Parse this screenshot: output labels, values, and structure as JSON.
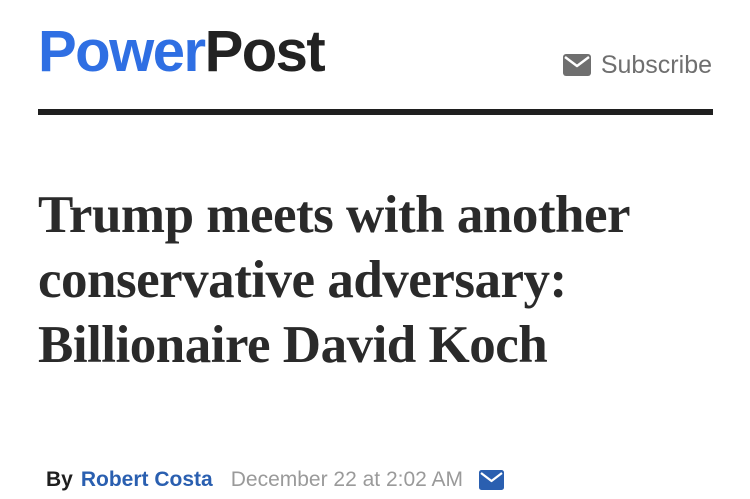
{
  "header": {
    "logo_part1": "Power",
    "logo_part2": "Post",
    "subscribe_label": "Subscribe",
    "subscribe_icon": "envelope-icon"
  },
  "article": {
    "headline": "Trump meets with another conservative adversary: Billionaire David Koch",
    "byline_prefix": "By",
    "author": "Robert Costa",
    "timestamp": "December 22 at 2:02 AM",
    "share_icon": "envelope-icon"
  },
  "colors": {
    "brand_blue": "#2f6fe3",
    "author_blue": "#2a5fb0",
    "text_dark": "#222222",
    "muted_gray": "#9a9a9a"
  }
}
